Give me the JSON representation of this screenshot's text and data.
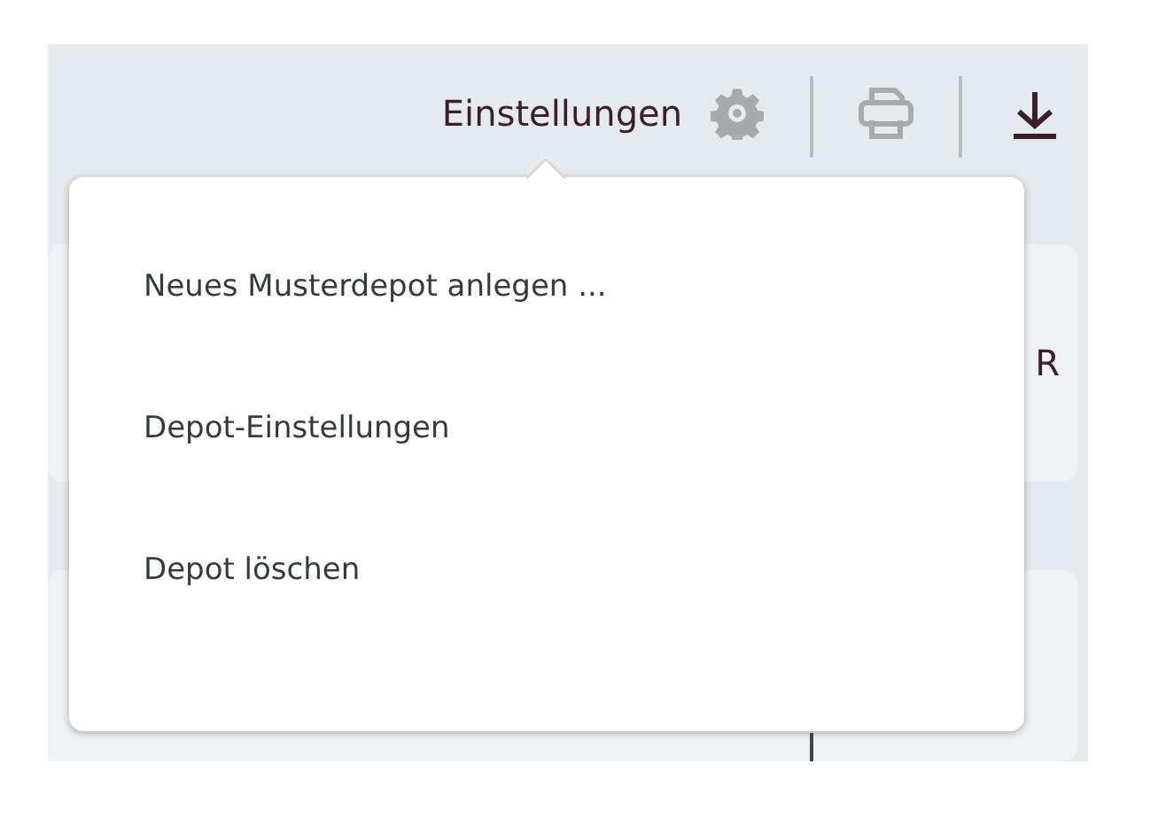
{
  "toolbar": {
    "settings_label": "Einstellungen"
  },
  "settings_menu": {
    "items": [
      {
        "label": "Neues Musterdepot anlegen ..."
      },
      {
        "label": "Depot-Einstellungen"
      },
      {
        "label": "Depot löschen"
      }
    ]
  },
  "cards": [
    {
      "text": "R"
    }
  ]
}
